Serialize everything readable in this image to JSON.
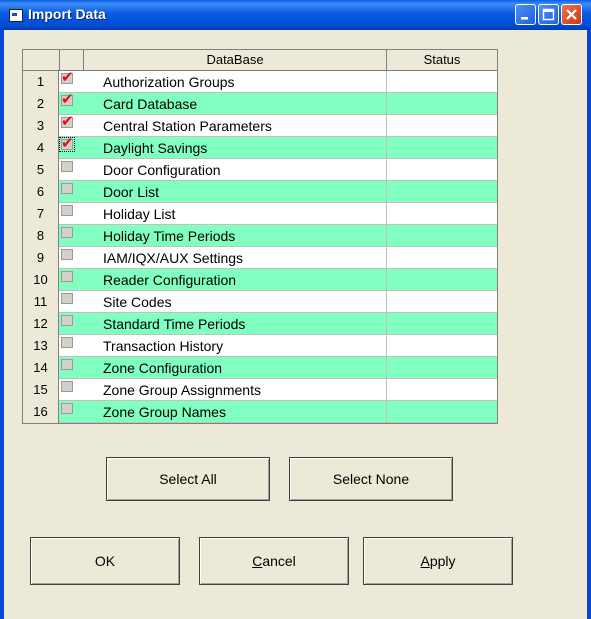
{
  "window": {
    "title": "Import Data",
    "controls": [
      "minimize-icon",
      "maximize-icon",
      "close-icon"
    ]
  },
  "grid": {
    "columns": [
      "DataBase",
      "Status"
    ],
    "rows": [
      {
        "num": "1",
        "name": "Authorization Groups",
        "checked": true,
        "status": ""
      },
      {
        "num": "2",
        "name": "Card Database",
        "checked": true,
        "status": ""
      },
      {
        "num": "3",
        "name": "Central Station Parameters",
        "checked": true,
        "status": ""
      },
      {
        "num": "4",
        "name": "Daylight Savings",
        "checked": true,
        "status": "",
        "focused": true
      },
      {
        "num": "5",
        "name": "Door Configuration",
        "checked": false,
        "status": ""
      },
      {
        "num": "6",
        "name": "Door List",
        "checked": false,
        "status": ""
      },
      {
        "num": "7",
        "name": "Holiday List",
        "checked": false,
        "status": ""
      },
      {
        "num": "8",
        "name": "Holiday Time Periods",
        "checked": false,
        "status": ""
      },
      {
        "num": "9",
        "name": "IAM/IQX/AUX Settings",
        "checked": false,
        "status": ""
      },
      {
        "num": "10",
        "name": "Reader Configuration",
        "checked": false,
        "status": ""
      },
      {
        "num": "11",
        "name": "Site Codes",
        "checked": false,
        "status": ""
      },
      {
        "num": "12",
        "name": "Standard Time Periods",
        "checked": false,
        "status": ""
      },
      {
        "num": "13",
        "name": "Transaction History",
        "checked": false,
        "status": ""
      },
      {
        "num": "14",
        "name": "Zone Configuration",
        "checked": false,
        "status": ""
      },
      {
        "num": "15",
        "name": "Zone Group Assignments",
        "checked": false,
        "status": ""
      },
      {
        "num": "16",
        "name": "Zone Group Names",
        "checked": false,
        "status": ""
      }
    ],
    "row_colors": {
      "odd": "#ffffff",
      "even": "#80FFC0"
    },
    "check_color": "#e01010"
  },
  "buttons": {
    "select_all": "Select All",
    "select_none": "Select None",
    "ok": "OK",
    "cancel": "Cancel",
    "apply": "Apply"
  }
}
